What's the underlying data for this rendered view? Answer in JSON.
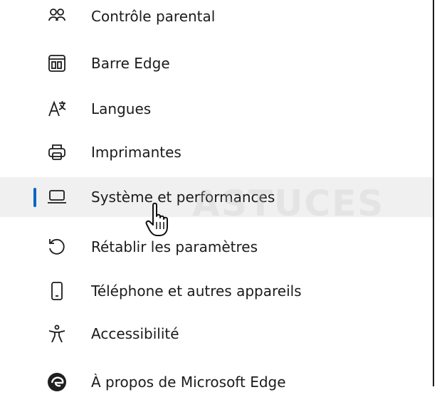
{
  "nav": {
    "items": [
      {
        "label": "Contrôle parental",
        "icon": "parental-control-icon"
      },
      {
        "label": "Barre Edge",
        "icon": "edge-bar-icon"
      },
      {
        "label": "Langues",
        "icon": "languages-icon"
      },
      {
        "label": "Imprimantes",
        "icon": "printer-icon"
      },
      {
        "label": "Système et performances",
        "icon": "laptop-icon",
        "selected": true
      },
      {
        "label": "Rétablir les paramètres",
        "icon": "reset-icon"
      },
      {
        "label": "Téléphone et autres appareils",
        "icon": "phone-icon"
      },
      {
        "label": "Accessibilité",
        "icon": "accessibility-icon"
      },
      {
        "label": "À propos de Microsoft Edge",
        "icon": "edge-logo-icon"
      }
    ]
  },
  "colors": {
    "accent": "#0067c0",
    "selected_bg": "#f0f0f0",
    "text": "#1b1b1b"
  }
}
